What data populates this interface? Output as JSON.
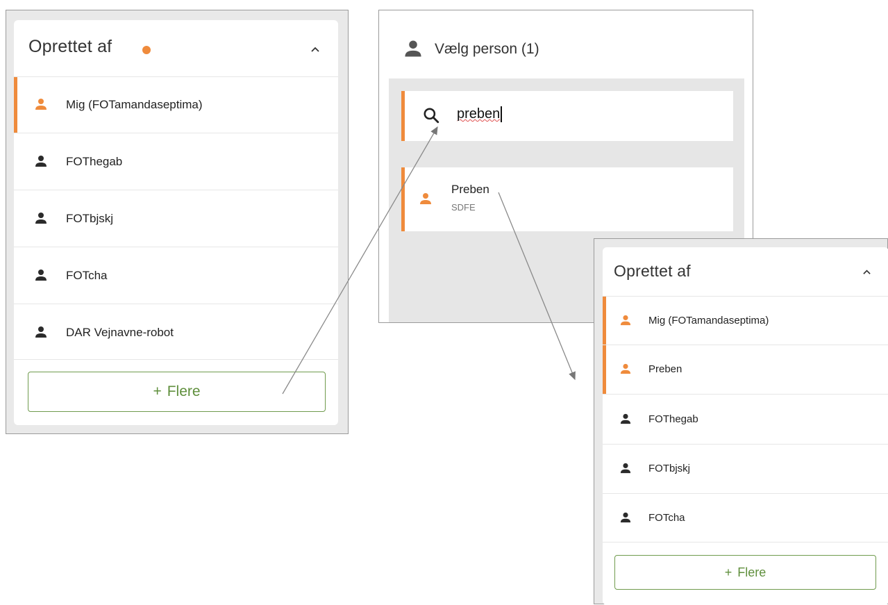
{
  "colors": {
    "accent": "#ef8b3c",
    "person_default": "#2b2b2b",
    "flere_green": "#5f8f3c",
    "panel_gray": "#e9e9e9",
    "search_gray": "#e6e6e6"
  },
  "panel_left": {
    "title": "Oprettet af",
    "status_dot": "orange-dot-icon",
    "items": [
      {
        "label": "Mig (FOTamandaseptima)",
        "selected": true
      },
      {
        "label": "FOThegab",
        "selected": false
      },
      {
        "label": "FOTbjskj",
        "selected": false
      },
      {
        "label": "FOTcha",
        "selected": false
      },
      {
        "label": "DAR Vejnavne-robot",
        "selected": false
      }
    ],
    "more_button": {
      "plus": "+",
      "label": "Flere"
    }
  },
  "panel_search": {
    "title": "Vælg person (1)",
    "search_value": "preben",
    "result": {
      "name": "Preben",
      "sub": "SDFE"
    }
  },
  "panel_right": {
    "title": "Oprettet af",
    "items": [
      {
        "label": "Mig (FOTamandaseptima)",
        "selected": true
      },
      {
        "label": "Preben",
        "selected": true
      },
      {
        "label": "FOThegab",
        "selected": false
      },
      {
        "label": "FOTbjskj",
        "selected": false
      },
      {
        "label": "FOTcha",
        "selected": false
      }
    ],
    "more_button": {
      "plus": "+",
      "label": "Flere"
    }
  }
}
